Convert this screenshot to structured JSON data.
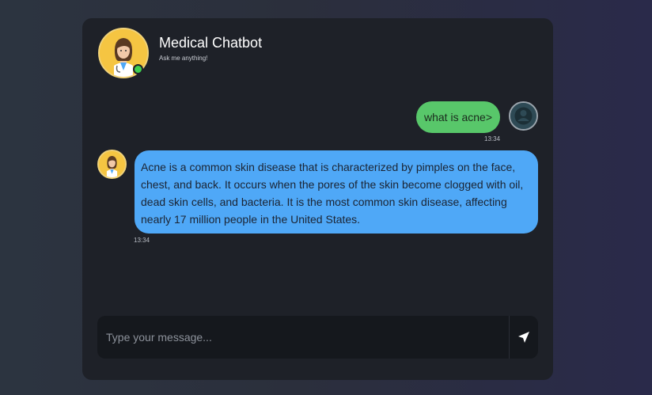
{
  "header": {
    "title": "Medical Chatbot",
    "subtitle": "Ask me anything!",
    "status_color": "#3fcf4f",
    "bot_avatar_icon": "doctor-avatar-icon"
  },
  "messages": [
    {
      "sender": "user",
      "text": "what is acne>",
      "time": "13:34",
      "bubble_color": "#58c76a",
      "avatar_icon": "user-avatar-icon"
    },
    {
      "sender": "bot",
      "text": "Acne is a common skin disease that is characterized by pimples on the face, chest, and back. It occurs when the pores of the skin become clogged with oil, dead skin cells, and bacteria. It is the most common skin disease, affecting nearly 17 million people in the United States.",
      "time": "13:34",
      "bubble_color": "#4fa8f7",
      "avatar_icon": "doctor-avatar-icon"
    }
  ],
  "composer": {
    "placeholder": "Type your message...",
    "value": "",
    "send_icon": "send-icon"
  }
}
